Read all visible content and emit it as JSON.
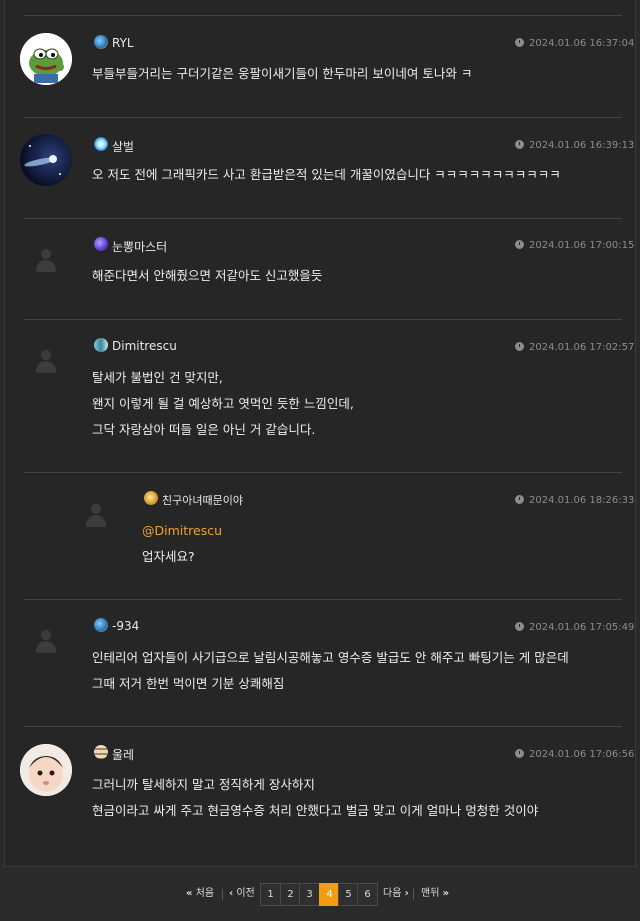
{
  "comments": [
    {
      "nick": "RYL",
      "time": "2024.01.06 16:37:04",
      "lines": [
        "부들부들거리는 구더기같은 웅팔이새기들이 한두마리 보이네여 토나와 ㅋ"
      ]
    },
    {
      "nick": "살벌",
      "time": "2024.01.06 16:39:13",
      "lines": [
        "오 저도 전에 그래픽카드 사고 환급받은적 있는데 개꿀이였습니다 ㅋㅋㅋㅋㅋㅋㅋㅋㅋㅋㅋ"
      ]
    },
    {
      "nick": "눈뽕마스터",
      "time": "2024.01.06 17:00:15",
      "lines": [
        "해준다면서 안해줬으면 저같아도 신고했을듯"
      ]
    },
    {
      "nick": "Dimitrescu",
      "time": "2024.01.06 17:02:57",
      "lines": [
        "탈세가 불법인 건 맞지만,",
        "왠지 이렇게 될 걸 예상하고 엿먹인 듯한 느낌인데,",
        "그닥 자랑삼아 떠들 일은 아닌 거 같습니다."
      ]
    },
    {
      "nick": "친구아녀때문이야",
      "time": "2024.01.06 18:26:33",
      "mention": "@Dimitrescu",
      "lines": [
        "업자세요?"
      ]
    },
    {
      "nick": "-934",
      "time": "2024.01.06 17:05:49",
      "lines": [
        "인테리어 업자들이 사기급으로 날림시공해놓고 영수증 발급도 안 해주고 빠팅기는 게 많은데",
        "그때 저거 한번 먹이면 기분 상쾌해짐"
      ]
    },
    {
      "nick": "울레",
      "time": "2024.01.06 17:06:56",
      "lines": [
        "그러니까 탈세하지 말고 정직하게 장사하지",
        "현금이라고 싸게 주고 현금영수증 처리 안했다고 벌금 맞고 이게 얼마나 멍청한 것이야"
      ]
    }
  ],
  "pagination": {
    "first": "처음",
    "prev": "이전",
    "pages": [
      "1",
      "2",
      "3",
      "4",
      "5",
      "6"
    ],
    "current": "4",
    "next": "다음",
    "last": "맨뒤"
  },
  "colors": {
    "accent": "#f39c12",
    "mention": "#f0a030"
  }
}
